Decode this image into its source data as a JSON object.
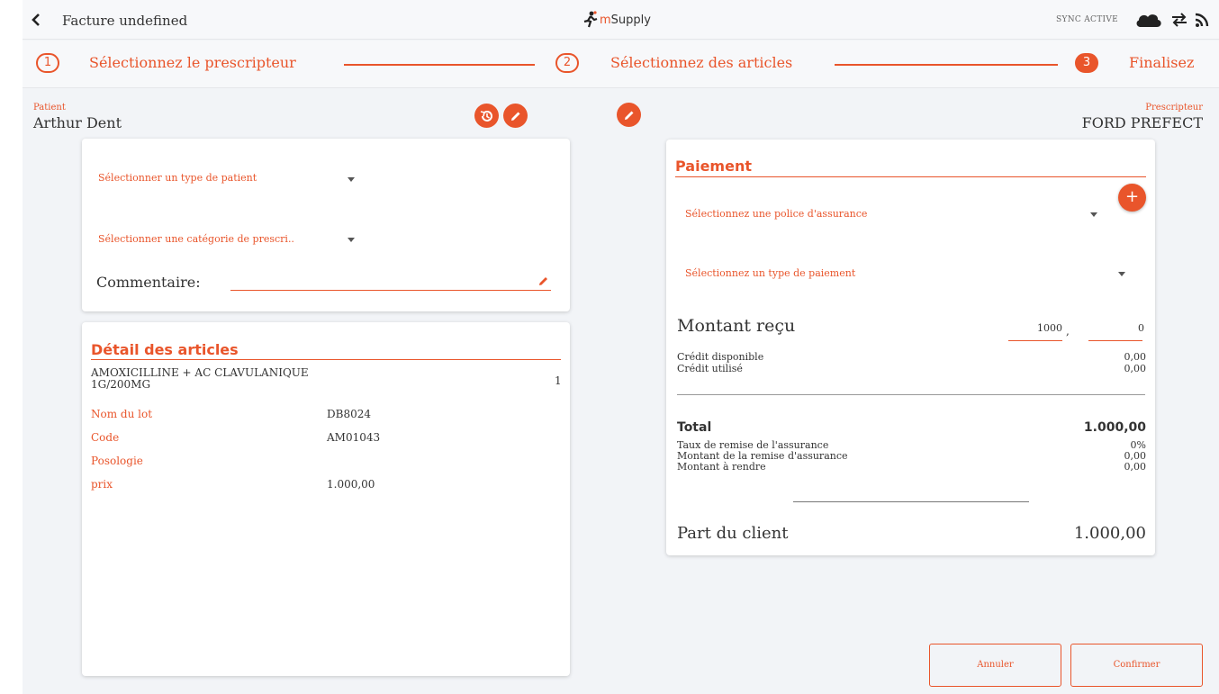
{
  "header": {
    "title": "Facture undefined",
    "logo_m": "m",
    "logo_rest": "Supply",
    "sync_status": "SYNC ACTIVE"
  },
  "stepper": [
    {
      "number": "1",
      "label": "Sélectionnez le prescripteur"
    },
    {
      "number": "2",
      "label": "Sélectionnez des articles"
    },
    {
      "number": "3",
      "label": "Finalisez"
    }
  ],
  "patient": {
    "label": "Patient",
    "name": "Arthur Dent"
  },
  "prescriber": {
    "label": "Prescripteur",
    "name": "FORD PREFECT"
  },
  "patient_form": {
    "patient_type_placeholder": "Sélectionner un type de patient",
    "prescription_category_placeholder": "Sélectionner une catégorie de prescri..",
    "comment_label": "Commentaire:",
    "comment_value": ""
  },
  "items": {
    "title": "Détail des articles",
    "item_name": "AMOXICILLINE + AC CLAVULANIQUE 1G/200MG",
    "quantity": "1",
    "fields": [
      {
        "key": "Nom du lot",
        "value": "DB8024"
      },
      {
        "key": "Code",
        "value": "AM01043"
      },
      {
        "key": "Posologie",
        "value": ""
      },
      {
        "key": "prix",
        "value": "1.000,00"
      }
    ]
  },
  "payment": {
    "title": "Paiement",
    "insurance_placeholder": "Sélectionnez une police d'assurance",
    "payment_type_placeholder": "Sélectionnez un type de paiement",
    "amount_label": "Montant reçu",
    "amount_whole": "1000",
    "amount_separator": ",",
    "amount_decimal": "0",
    "credit_available_label": "Crédit disponible",
    "credit_available_value": "0,00",
    "credit_used_label": "Crédit utilisé",
    "credit_used_value": "0,00",
    "total_label": "Total",
    "total_value": "1.000,00",
    "insurance_discount_rate_label": "Taux de remise de l'assurance",
    "insurance_discount_rate_value": "0%",
    "insurance_discount_amount_label": "Montant de la remise d'assurance",
    "insurance_discount_amount_value": "0,00",
    "change_label": "Montant à rendre",
    "change_value": "0,00",
    "client_share_label": "Part du client",
    "client_share_value": "1.000,00"
  },
  "actions": {
    "cancel": "Annuler",
    "confirm": "Confirmer"
  },
  "colors": {
    "accent": "#e9552b",
    "background": "#f2f4f7",
    "card": "#ffffff"
  }
}
